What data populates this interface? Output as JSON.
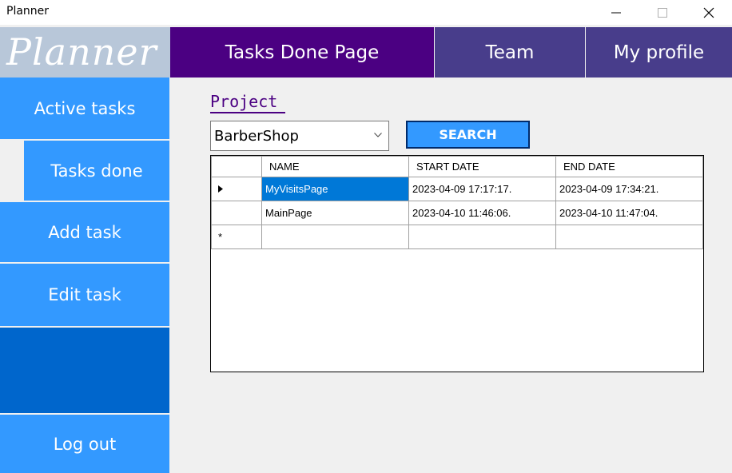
{
  "window": {
    "title": "Planner"
  },
  "header": {
    "logo": "Planner",
    "nav": [
      {
        "label": "Tasks Done Page"
      },
      {
        "label": "Team"
      },
      {
        "label": "My profile"
      }
    ]
  },
  "sidebar": {
    "items": [
      {
        "label": "Active tasks"
      },
      {
        "label": "Tasks done"
      },
      {
        "label": "Add task"
      },
      {
        "label": "Edit task"
      },
      {
        "label": ""
      },
      {
        "label": "Log out"
      }
    ]
  },
  "main": {
    "project_label": "Project",
    "project_select": {
      "value": "BarberShop"
    },
    "search_label": "SEARCH",
    "grid": {
      "columns": [
        "NAME",
        "START DATE",
        "END DATE"
      ],
      "rows": [
        {
          "name": "MyVisitsPage",
          "start": "2023-04-09 17:17:17.",
          "end": "2023-04-09 17:34:21."
        },
        {
          "name": "MainPage",
          "start": "2023-04-10 11:46:06.",
          "end": "2023-04-10 11:47:04."
        }
      ],
      "new_row_marker": "*"
    }
  },
  "colors": {
    "nav_active": "#4b0082",
    "nav_inactive": "#483d8b",
    "sidebar": "#3399ff",
    "selection": "#0078d7"
  }
}
